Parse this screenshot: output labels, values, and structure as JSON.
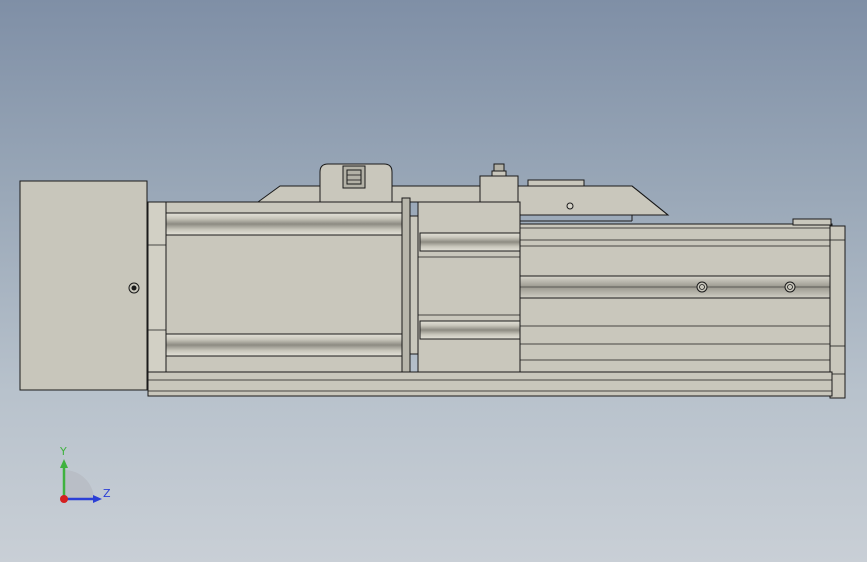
{
  "viewport": {
    "background_top": "#7f8fa6",
    "background_bottom": "#c9cfd6"
  },
  "model": {
    "body_color": "#c9c7bc",
    "edge_color": "#1a1a1a",
    "shade_color": "#8e8c82"
  },
  "triad": {
    "y_label": "Y",
    "z_label": "Z",
    "y_color": "#3fb23f",
    "z_color": "#2b3fd6",
    "x_color": "#d42020"
  }
}
